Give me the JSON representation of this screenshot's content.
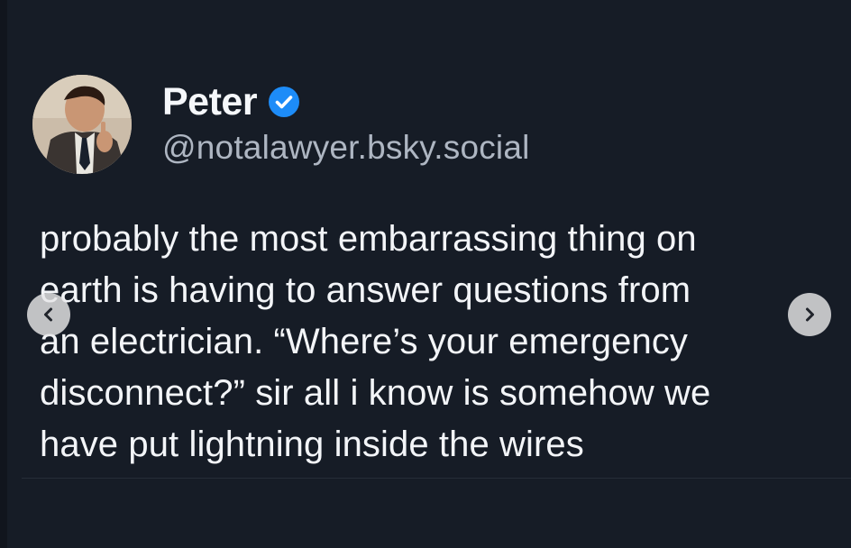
{
  "post": {
    "author": {
      "name": "Peter",
      "handle": "@notalawyer.bsky.social",
      "verified": true,
      "verified_color": "#1d8cf8"
    },
    "text_lines": [
      "probably the most embarrassing thing on",
      "earth is having to answer questions from",
      "an electrician. “Where’s your emergency",
      "disconnect?” sir all i know is somehow we",
      "have put lightning inside the wires"
    ]
  },
  "carousel": {
    "prev_icon": "chevron-left-icon",
    "next_icon": "chevron-right-icon"
  },
  "theme": {
    "background": "#161c26",
    "text": "#f3f5f8",
    "muted_text": "#aeb6c2"
  }
}
